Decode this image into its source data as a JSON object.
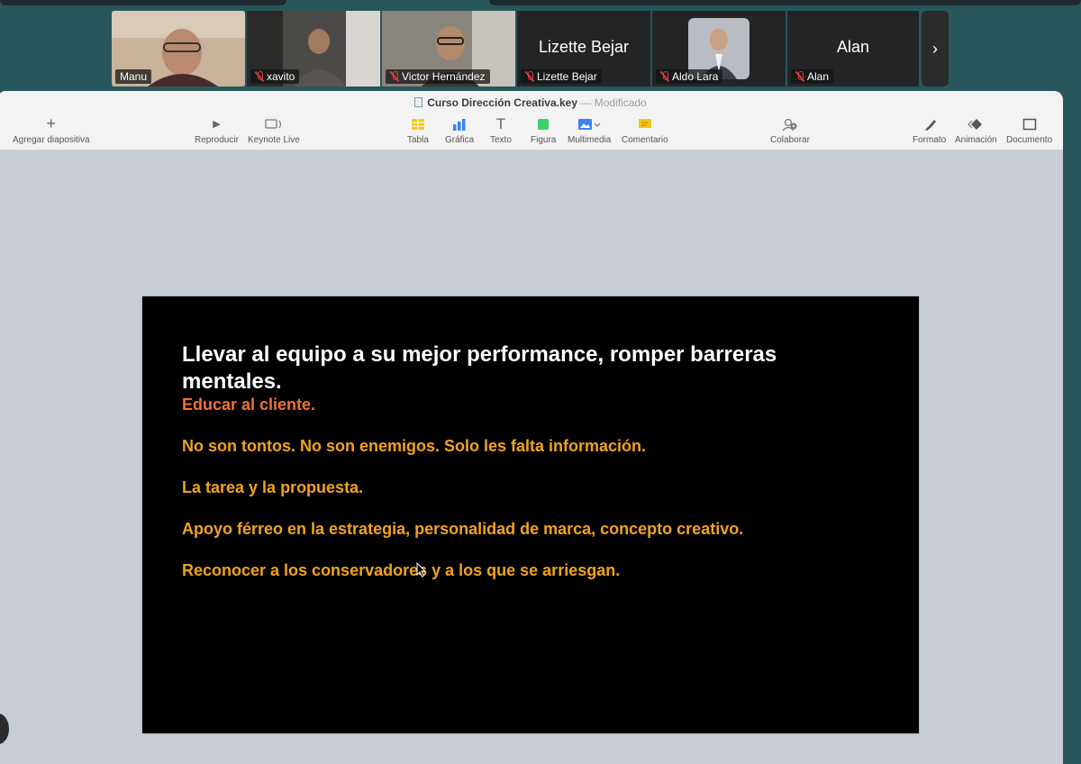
{
  "meeting": {
    "participants": [
      {
        "name": "Manu",
        "type": "video",
        "muted": false,
        "active": true
      },
      {
        "name": "xavito",
        "type": "video",
        "muted": true,
        "active": false
      },
      {
        "name": "Victor Hernández",
        "type": "video",
        "muted": true,
        "active": false
      },
      {
        "name": "Lizette Bejar",
        "display_name": "Lizette Bejar",
        "type": "name",
        "muted": true,
        "active": false
      },
      {
        "name": "Aldo Lara",
        "type": "photo",
        "muted": true,
        "active": false
      },
      {
        "name": "Alan",
        "display_name": "Alan",
        "type": "name",
        "muted": true,
        "active": false
      }
    ],
    "next_icon": "chevron-right-icon"
  },
  "keynote": {
    "document_name": "Curso Dirección Creativa.key",
    "separator": "—",
    "status": "Modificado",
    "toolbar": {
      "add_slide": "Agregar diapositiva",
      "play": "Reproducir",
      "keynote_live": "Keynote Live",
      "table": "Tabla",
      "chart": "Gráfica",
      "text": "Texto",
      "shape": "Figura",
      "media": "Multimedia",
      "comment": "Comentario",
      "collaborate": "Colaborar",
      "format": "Formato",
      "animate": "Animación",
      "document": "Documento"
    }
  },
  "slide": {
    "title": "Llevar al equipo a su mejor performance, romper barreras mentales.",
    "subtitle": "Educar al cliente.",
    "lines": [
      "No son tontos. No son enemigos. Solo les falta información.",
      "La tarea y la propuesta.",
      "Apoyo férreo en la estrategia, personalidad de marca, concepto creativo.",
      "Reconocer a los conservadores y a los que se arriesgan."
    ],
    "colors": {
      "background": "#000000",
      "title": "#ffffff",
      "subtitle": "#f07331",
      "body": "#f1a31c"
    }
  }
}
